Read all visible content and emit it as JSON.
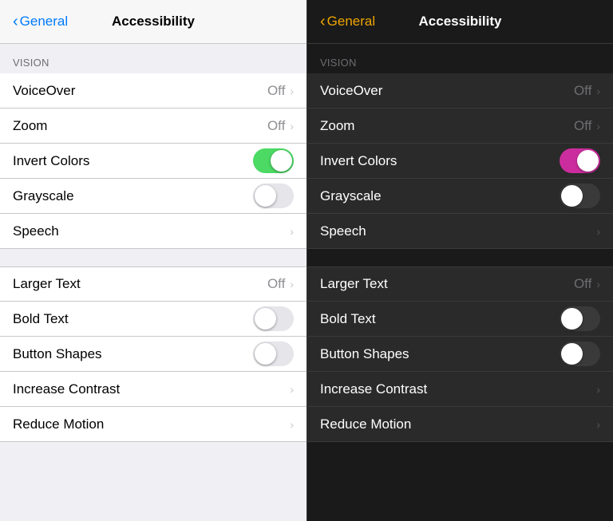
{
  "light": {
    "header": {
      "back_label": "General",
      "title": "Accessibility"
    },
    "vision_section": {
      "label": "VISION",
      "rows": [
        {
          "id": "voiceover",
          "label": "VoiceOver",
          "type": "nav",
          "value": "Off"
        },
        {
          "id": "zoom",
          "label": "Zoom",
          "type": "nav",
          "value": "Off"
        },
        {
          "id": "invert-colors",
          "label": "Invert Colors",
          "type": "toggle",
          "on": true
        },
        {
          "id": "grayscale",
          "label": "Grayscale",
          "type": "toggle",
          "on": false
        },
        {
          "id": "speech",
          "label": "Speech",
          "type": "nav",
          "value": ""
        }
      ]
    },
    "text_section": {
      "rows": [
        {
          "id": "larger-text",
          "label": "Larger Text",
          "type": "nav",
          "value": "Off"
        },
        {
          "id": "bold-text",
          "label": "Bold Text",
          "type": "toggle",
          "on": false
        },
        {
          "id": "button-shapes",
          "label": "Button Shapes",
          "type": "toggle",
          "on": false
        },
        {
          "id": "increase-contrast",
          "label": "Increase Contrast",
          "type": "nav",
          "value": ""
        },
        {
          "id": "reduce-motion",
          "label": "Reduce Motion",
          "type": "nav",
          "value": ""
        }
      ]
    }
  },
  "dark": {
    "header": {
      "back_label": "General",
      "title": "Accessibility"
    },
    "vision_section": {
      "label": "VISION",
      "rows": [
        {
          "id": "voiceover",
          "label": "VoiceOver",
          "type": "nav",
          "value": "Off"
        },
        {
          "id": "zoom",
          "label": "Zoom",
          "type": "nav",
          "value": "Off"
        },
        {
          "id": "invert-colors",
          "label": "Invert Colors",
          "type": "toggle",
          "on": true
        },
        {
          "id": "grayscale",
          "label": "Grayscale",
          "type": "toggle",
          "on": false
        },
        {
          "id": "speech",
          "label": "Speech",
          "type": "nav",
          "value": ""
        }
      ]
    },
    "text_section": {
      "rows": [
        {
          "id": "larger-text",
          "label": "Larger Text",
          "type": "nav",
          "value": "Off"
        },
        {
          "id": "bold-text",
          "label": "Bold Text",
          "type": "toggle",
          "on": false
        },
        {
          "id": "button-shapes",
          "label": "Button Shapes",
          "type": "toggle",
          "on": false
        },
        {
          "id": "increase-contrast",
          "label": "Increase Contrast",
          "type": "nav",
          "value": ""
        },
        {
          "id": "reduce-motion",
          "label": "Reduce Motion",
          "type": "nav",
          "value": ""
        }
      ]
    }
  },
  "chevron_char": "›",
  "back_chevron_char": "‹"
}
